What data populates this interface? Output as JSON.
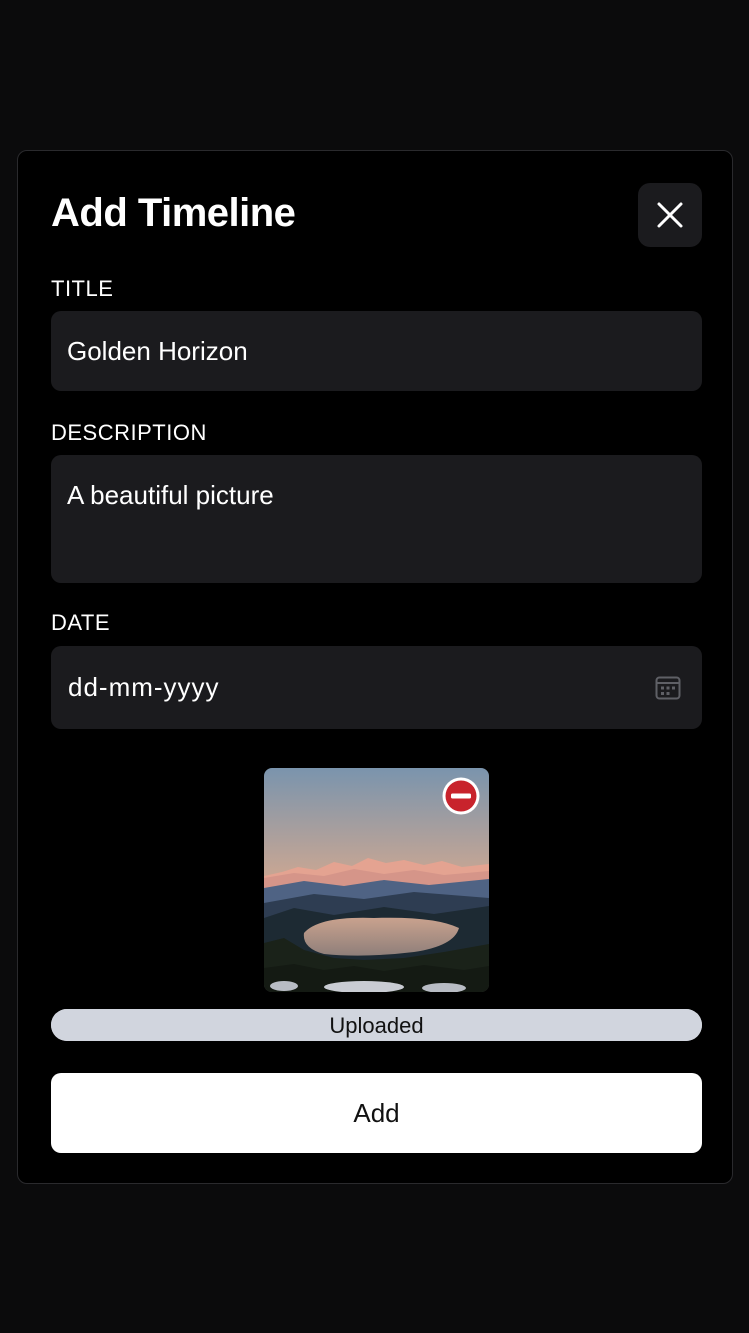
{
  "modal": {
    "title": "Add Timeline",
    "close_icon": "close-icon"
  },
  "form": {
    "title": {
      "label": "TITLE",
      "value": "Golden Horizon"
    },
    "description": {
      "label": "DESCRIPTION",
      "value": "A beautiful picture"
    },
    "date": {
      "label": "DATE",
      "placeholder": "dd-mm-yyyy",
      "icon": "calendar-icon"
    }
  },
  "upload": {
    "preview_icon": "landscape-photo",
    "remove_icon": "minus-circle-icon",
    "status": "Uploaded",
    "progress_percent": 100
  },
  "actions": {
    "add_label": "Add"
  },
  "colors": {
    "background": "#0b0b0c",
    "modal": "#000000",
    "field": "#1b1b1e",
    "progress": "#d1d5de",
    "remove": "#c8232c",
    "button": "#ffffff"
  }
}
